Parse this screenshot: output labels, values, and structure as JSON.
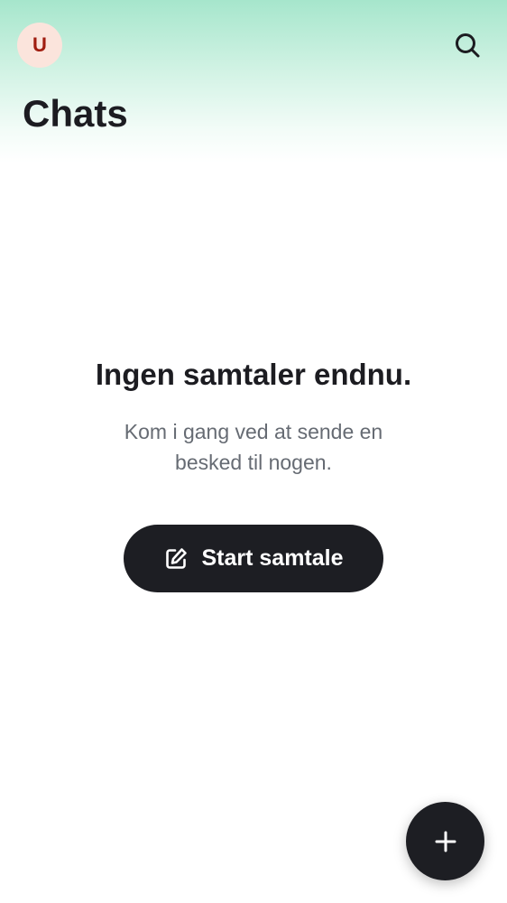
{
  "header": {
    "avatar_initial": "U",
    "title": "Chats",
    "search_icon": "search-icon"
  },
  "empty_state": {
    "title": "Ingen samtaler endnu.",
    "subtitle": "Kom i gang ved at sende en besked til nogen.",
    "button_label": "Start samtale",
    "button_icon": "edit-icon"
  },
  "fab": {
    "icon": "plus-icon"
  },
  "colors": {
    "header_gradient_top": "#a6e6cc",
    "avatar_bg": "#fbe4dc",
    "avatar_text": "#a01d10",
    "primary_dark": "#1d1e23",
    "subtitle_text": "#666b73"
  }
}
